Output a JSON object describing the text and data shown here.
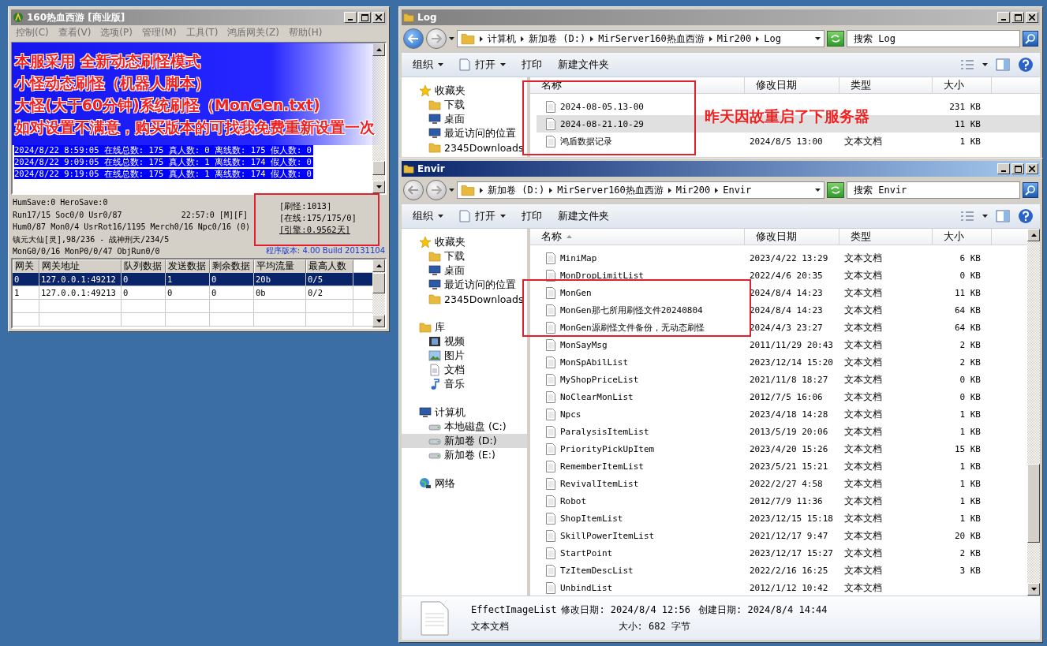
{
  "server_window": {
    "title": "160热血西游 [商业版]",
    "menu": [
      "控制(C)",
      "查看(V)",
      "选项(P)",
      "管理(M)",
      "工具(T)",
      "鸿盾网关(Z)",
      "帮助(H)"
    ],
    "log_lines": [
      "2024/8/22 8:59:05 在线总数: 175 真人数: 0 离线数: 175 假人数: 0",
      "2024/8/22 9:09:05 在线总数: 175 真人数: 1 离线数: 174 假人数: 0",
      "2024/8/22 9:19:05 在线总数: 175 真人数: 1 离线数: 174 假人数: 0"
    ],
    "status_lines": [
      "HumSave:0 HeroSave:0",
      "Run17/15 Soc0/0 Usr0/87",
      "Hum0/87 Mon0/4 UsrRot16/1195 Merch0/16 Npc0/16 (0)",
      "镇元大仙[灵],98/236 - 战神刑天/234/5",
      "MonG0/0/16 MonP0/0/47 ObjRun0/0"
    ],
    "clock": "22:57:0 [M][F]",
    "counters": [
      {
        "text": "[刷怪:1013]",
        "link": false
      },
      {
        "text": "[在线:175/175/0]",
        "link": false
      },
      {
        "text": "[引擎:0.9562天]",
        "link": true
      }
    ],
    "version": "程序版本: 4.00 Build 20131104",
    "gates": {
      "columns": [
        "网关",
        "网关地址",
        "队列数据",
        "发送数据",
        "剩余数据",
        "平均流量",
        "最高人数"
      ],
      "rows": [
        {
          "cells": [
            "0",
            "127.0.0.1:49212",
            "0",
            "1",
            "0",
            "20b",
            "0/5"
          ],
          "selected": true
        },
        {
          "cells": [
            "1",
            "127.0.0.1:49213",
            "0",
            "0",
            "0",
            "0b",
            "0/2"
          ],
          "selected": false
        }
      ]
    }
  },
  "banner": [
    "本服采用 全新动态刷怪模式",
    "小怪动态刷怪（机器人脚本）",
    "大怪(大于60分钟)系统刷怪（MonGen.txt)",
    "如对设置不满意，购买版本的可找我免费重新设置一次"
  ],
  "log_window": {
    "title": "Log",
    "back_enabled": true,
    "path": [
      "计算机",
      "新加卷 (D:)",
      "MirServer160热血西游",
      "Mir200",
      "Log"
    ],
    "search_placeholder": "搜索 Log",
    "toolbar": [
      {
        "label": "组织",
        "dropdown": true,
        "kind": "plain"
      },
      {
        "label": "打开",
        "dropdown": true,
        "kind": "file"
      },
      {
        "label": "打印",
        "dropdown": false,
        "kind": "plain"
      },
      {
        "label": "新建文件夹",
        "dropdown": false,
        "kind": "plain"
      }
    ],
    "nav": [
      {
        "label": "收藏夹",
        "kind": "star",
        "selected": false,
        "children": [
          {
            "label": "下载",
            "kind": "folder",
            "selected": false
          },
          {
            "label": "桌面",
            "kind": "monitor",
            "selected": false
          },
          {
            "label": "最近访问的位置",
            "kind": "monitor",
            "selected": false
          },
          {
            "label": "2345Downloads",
            "kind": "folder",
            "selected": false
          }
        ]
      }
    ],
    "columns": [
      {
        "label": "名称",
        "sorted": false
      },
      {
        "label": "修改日期",
        "sorted": false
      },
      {
        "label": "类型",
        "sorted": false
      },
      {
        "label": "大小",
        "sorted": false
      }
    ],
    "files": [
      {
        "name": "2024-08-05.13-00",
        "size": "231 KB",
        "selected": false
      },
      {
        "name": "2024-08-21.10-29",
        "size": "11 KB",
        "selected": true
      },
      {
        "name": "鸿盾数据记录",
        "date": "2024/8/5 13:00",
        "type": "文本文档",
        "size": "1 KB",
        "selected": false
      }
    ]
  },
  "note": "昨天因故重启了下服务器",
  "envir_window": {
    "title": "Envir",
    "back_enabled": false,
    "path": [
      "新加卷 (D:)",
      "MirServer160热血西游",
      "Mir200",
      "Envir"
    ],
    "search_placeholder": "搜索 Envir",
    "toolbar": [
      {
        "label": "组织",
        "dropdown": true,
        "kind": "plain"
      },
      {
        "label": "打开",
        "dropdown": true,
        "kind": "file"
      },
      {
        "label": "打印",
        "dropdown": false,
        "kind": "plain"
      },
      {
        "label": "新建文件夹",
        "dropdown": false,
        "kind": "plain"
      }
    ],
    "nav": [
      {
        "label": "收藏夹",
        "kind": "star",
        "selected": false,
        "children": [
          {
            "label": "下载",
            "kind": "folder",
            "selected": false
          },
          {
            "label": "桌面",
            "kind": "monitor",
            "selected": false
          },
          {
            "label": "最近访问的位置",
            "kind": "monitor",
            "selected": false
          },
          {
            "label": "2345Downloads",
            "kind": "folder",
            "selected": false
          }
        ]
      },
      {
        "label": "库",
        "kind": "folder",
        "selected": false,
        "children": [
          {
            "label": "视频",
            "kind": "film",
            "selected": false
          },
          {
            "label": "图片",
            "kind": "picture",
            "selected": false
          },
          {
            "label": "文档",
            "kind": "document",
            "selected": false
          },
          {
            "label": "音乐",
            "kind": "music",
            "selected": false
          }
        ]
      },
      {
        "label": "计算机",
        "kind": "monitor",
        "selected": false,
        "children": [
          {
            "label": "本地磁盘 (C:)",
            "kind": "drive",
            "selected": false
          },
          {
            "label": "新加卷 (D:)",
            "kind": "drive",
            "selected": true
          },
          {
            "label": "新加卷 (E:)",
            "kind": "drive",
            "selected": false
          }
        ]
      },
      {
        "label": "网络",
        "kind": "globe",
        "selected": false
      }
    ],
    "columns": [
      {
        "label": "名称",
        "sorted": true
      },
      {
        "label": "修改日期",
        "sorted": false
      },
      {
        "label": "类型",
        "sorted": false
      },
      {
        "label": "大小",
        "sorted": false
      }
    ],
    "files": [
      {
        "name": "MiniMap",
        "date": "2023/4/22 13:29",
        "type": "文本文档",
        "size": "6 KB",
        "selected": false
      },
      {
        "name": "MonDropLimitList",
        "date": "2022/4/6 20:35",
        "type": "文本文档",
        "size": "0 KB",
        "selected": false
      },
      {
        "name": "MonGen",
        "date": "2024/8/4 14:23",
        "type": "文本文档",
        "size": "11 KB",
        "selected": false
      },
      {
        "name": "MonGen那七所用刷怪文件20240804",
        "date": "2024/8/4 14:23",
        "type": "文本文档",
        "size": "64 KB",
        "selected": false
      },
      {
        "name": "MonGen源刷怪文件备份，无动态刷怪",
        "date": "2024/4/3 23:27",
        "type": "文本文档",
        "size": "64 KB",
        "selected": false
      },
      {
        "name": "MonSayMsg",
        "date": "2011/11/29 20:43",
        "type": "文本文档",
        "size": "2 KB",
        "selected": false
      },
      {
        "name": "MonSpAbilList",
        "date": "2023/12/14 15:20",
        "type": "文本文档",
        "size": "2 KB",
        "selected": false
      },
      {
        "name": "MyShopPriceList",
        "date": "2021/11/8 18:27",
        "type": "文本文档",
        "size": "0 KB",
        "selected": false
      },
      {
        "name": "NoClearMonList",
        "date": "2012/7/5 16:06",
        "type": "文本文档",
        "size": "0 KB",
        "selected": false
      },
      {
        "name": "Npcs",
        "date": "2023/4/18 14:28",
        "type": "文本文档",
        "size": "1 KB",
        "selected": false
      },
      {
        "name": "ParalysisItemList",
        "date": "2013/5/19 20:06",
        "type": "文本文档",
        "size": "1 KB",
        "selected": false
      },
      {
        "name": "PriorityPickUpItem",
        "date": "2023/4/20 15:26",
        "type": "文本文档",
        "size": "15 KB",
        "selected": false
      },
      {
        "name": "RememberItemList",
        "date": "2023/5/21 15:21",
        "type": "文本文档",
        "size": "1 KB",
        "selected": false
      },
      {
        "name": "RevivalItemList",
        "date": "2022/2/27 4:58",
        "type": "文本文档",
        "size": "1 KB",
        "selected": false
      },
      {
        "name": "Robot",
        "date": "2012/7/9 11:36",
        "type": "文本文档",
        "size": "1 KB",
        "selected": false
      },
      {
        "name": "ShopItemList",
        "date": "2023/12/15 15:18",
        "type": "文本文档",
        "size": "1 KB",
        "selected": false
      },
      {
        "name": "SkillPowerItemList",
        "date": "2021/12/17 9:47",
        "type": "文本文档",
        "size": "20 KB",
        "selected": false
      },
      {
        "name": "StartPoint",
        "date": "2023/12/17 15:27",
        "type": "文本文档",
        "size": "2 KB",
        "selected": false
      },
      {
        "name": "TzItemDescList",
        "date": "2022/2/16 16:25",
        "type": "文本文档",
        "size": "3 KB",
        "selected": false
      },
      {
        "name": "UnbindList",
        "date": "2012/1/12 10:42",
        "type": "文本文档",
        "selected": false
      }
    ],
    "details": {
      "name": "EffectImageList",
      "modified": "修改日期: 2024/8/4 12:56",
      "created": "创建日期: 2024/8/4 14:44",
      "type": "文本文档",
      "size": "大小: 682 字节"
    }
  }
}
